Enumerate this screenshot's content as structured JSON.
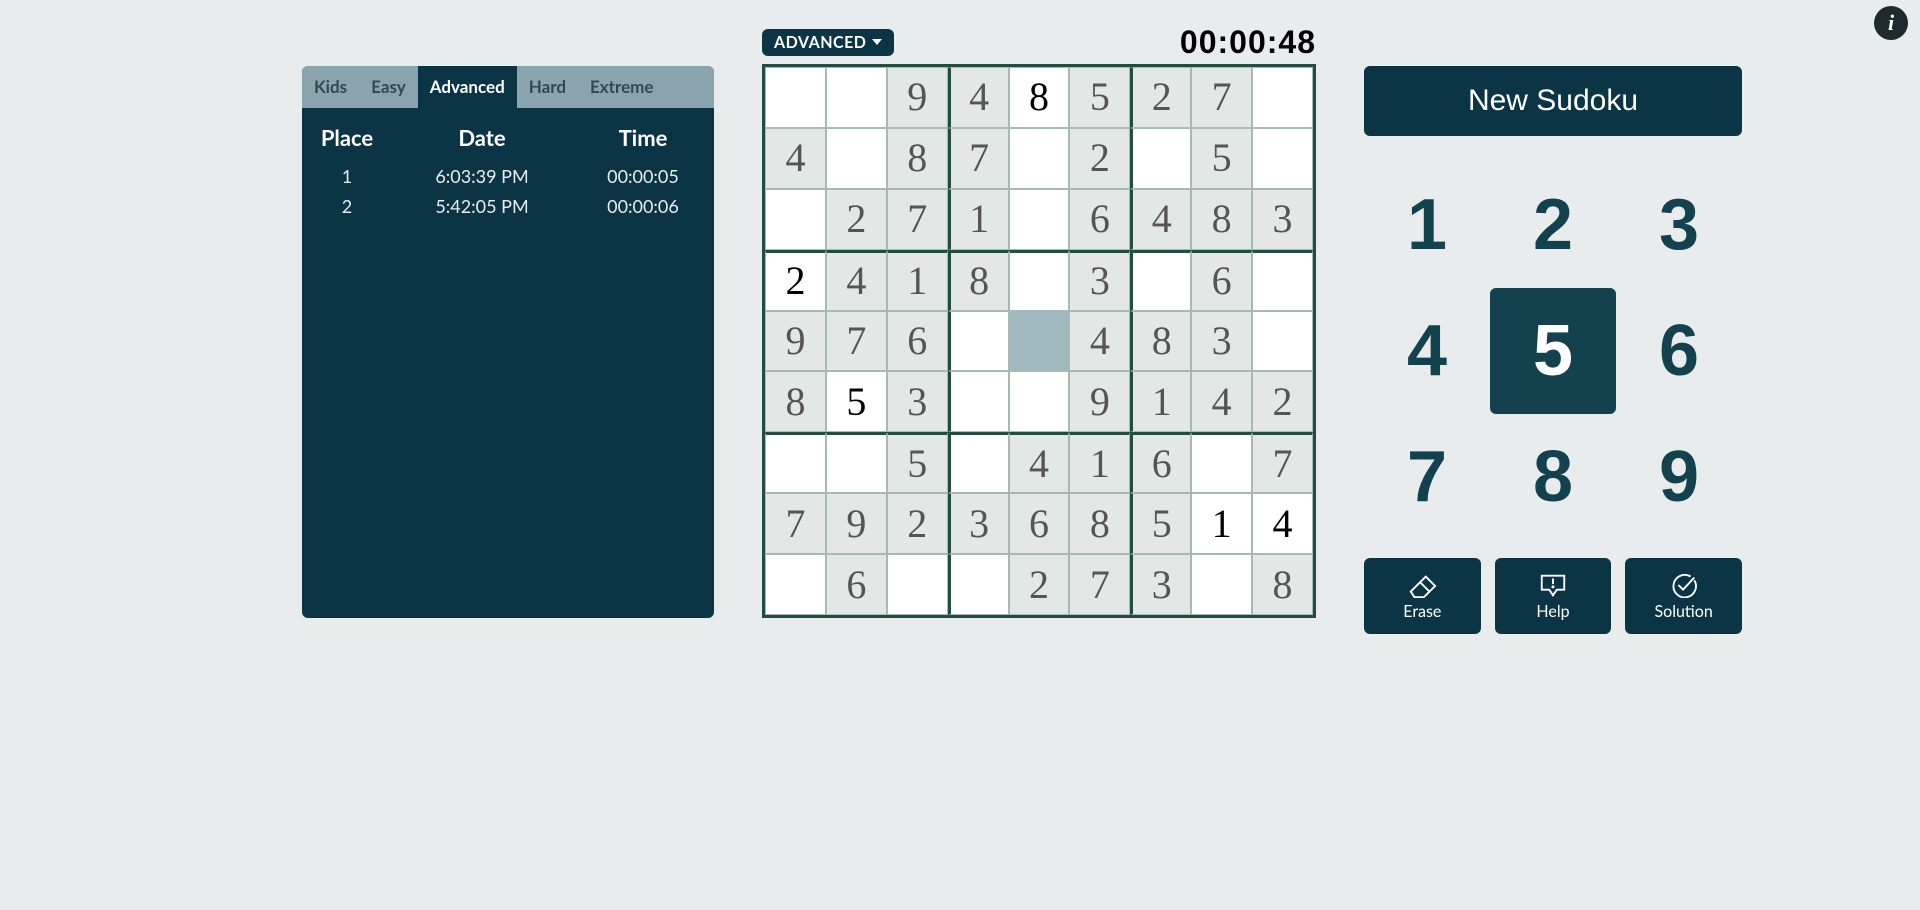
{
  "info_glyph": "i",
  "difficulty_dropdown": "ADVANCED",
  "timer": "00:00:48",
  "new_button": "New Sudoku",
  "tabs": [
    "Kids",
    "Easy",
    "Advanced",
    "Hard",
    "Extreme"
  ],
  "active_tab_index": 2,
  "leaderboard": {
    "headers": {
      "place": "Place",
      "date": "Date",
      "time": "Time"
    },
    "rows": [
      {
        "place": "1",
        "date": "6:03:39 PM",
        "time": "00:00:05"
      },
      {
        "place": "2",
        "date": "5:42:05 PM",
        "time": "00:00:06"
      }
    ]
  },
  "board": {
    "selected": [
      4,
      4
    ],
    "cells": [
      [
        null,
        null,
        {
          "v": 9,
          "g": true
        },
        {
          "v": 4,
          "g": true
        },
        {
          "v": 8,
          "g": false
        },
        {
          "v": 5,
          "g": true
        },
        {
          "v": 2,
          "g": true
        },
        {
          "v": 7,
          "g": true
        },
        null
      ],
      [
        {
          "v": 4,
          "g": true
        },
        null,
        {
          "v": 8,
          "g": true
        },
        {
          "v": 7,
          "g": true
        },
        null,
        {
          "v": 2,
          "g": true
        },
        null,
        {
          "v": 5,
          "g": true
        },
        null
      ],
      [
        null,
        {
          "v": 2,
          "g": true
        },
        {
          "v": 7,
          "g": true
        },
        {
          "v": 1,
          "g": true
        },
        null,
        {
          "v": 6,
          "g": true
        },
        {
          "v": 4,
          "g": true
        },
        {
          "v": 8,
          "g": true
        },
        {
          "v": 3,
          "g": true
        }
      ],
      [
        {
          "v": 2,
          "g": false
        },
        {
          "v": 4,
          "g": true
        },
        {
          "v": 1,
          "g": true
        },
        {
          "v": 8,
          "g": true
        },
        null,
        {
          "v": 3,
          "g": true
        },
        null,
        {
          "v": 6,
          "g": true
        },
        null
      ],
      [
        {
          "v": 9,
          "g": true
        },
        {
          "v": 7,
          "g": true
        },
        {
          "v": 6,
          "g": true
        },
        null,
        null,
        {
          "v": 4,
          "g": true
        },
        {
          "v": 8,
          "g": true
        },
        {
          "v": 3,
          "g": true
        },
        null
      ],
      [
        {
          "v": 8,
          "g": true
        },
        {
          "v": 5,
          "g": false
        },
        {
          "v": 3,
          "g": true
        },
        null,
        null,
        {
          "v": 9,
          "g": true
        },
        {
          "v": 1,
          "g": true
        },
        {
          "v": 4,
          "g": true
        },
        {
          "v": 2,
          "g": true
        }
      ],
      [
        null,
        null,
        {
          "v": 5,
          "g": true
        },
        null,
        {
          "v": 4,
          "g": true
        },
        {
          "v": 1,
          "g": true
        },
        {
          "v": 6,
          "g": true
        },
        null,
        {
          "v": 7,
          "g": true
        }
      ],
      [
        {
          "v": 7,
          "g": true
        },
        {
          "v": 9,
          "g": true
        },
        {
          "v": 2,
          "g": true
        },
        {
          "v": 3,
          "g": true
        },
        {
          "v": 6,
          "g": true
        },
        {
          "v": 8,
          "g": true
        },
        {
          "v": 5,
          "g": true
        },
        {
          "v": 1,
          "g": false
        },
        {
          "v": 4,
          "g": false
        }
      ],
      [
        null,
        {
          "v": 6,
          "g": true
        },
        null,
        null,
        {
          "v": 2,
          "g": true
        },
        {
          "v": 7,
          "g": true
        },
        {
          "v": 3,
          "g": true
        },
        null,
        {
          "v": 8,
          "g": true
        }
      ]
    ]
  },
  "numpad": {
    "selected": 5,
    "values": [
      1,
      2,
      3,
      4,
      5,
      6,
      7,
      8,
      9
    ]
  },
  "tools": {
    "erase": "Erase",
    "help": "Help",
    "solution": "Solution"
  }
}
